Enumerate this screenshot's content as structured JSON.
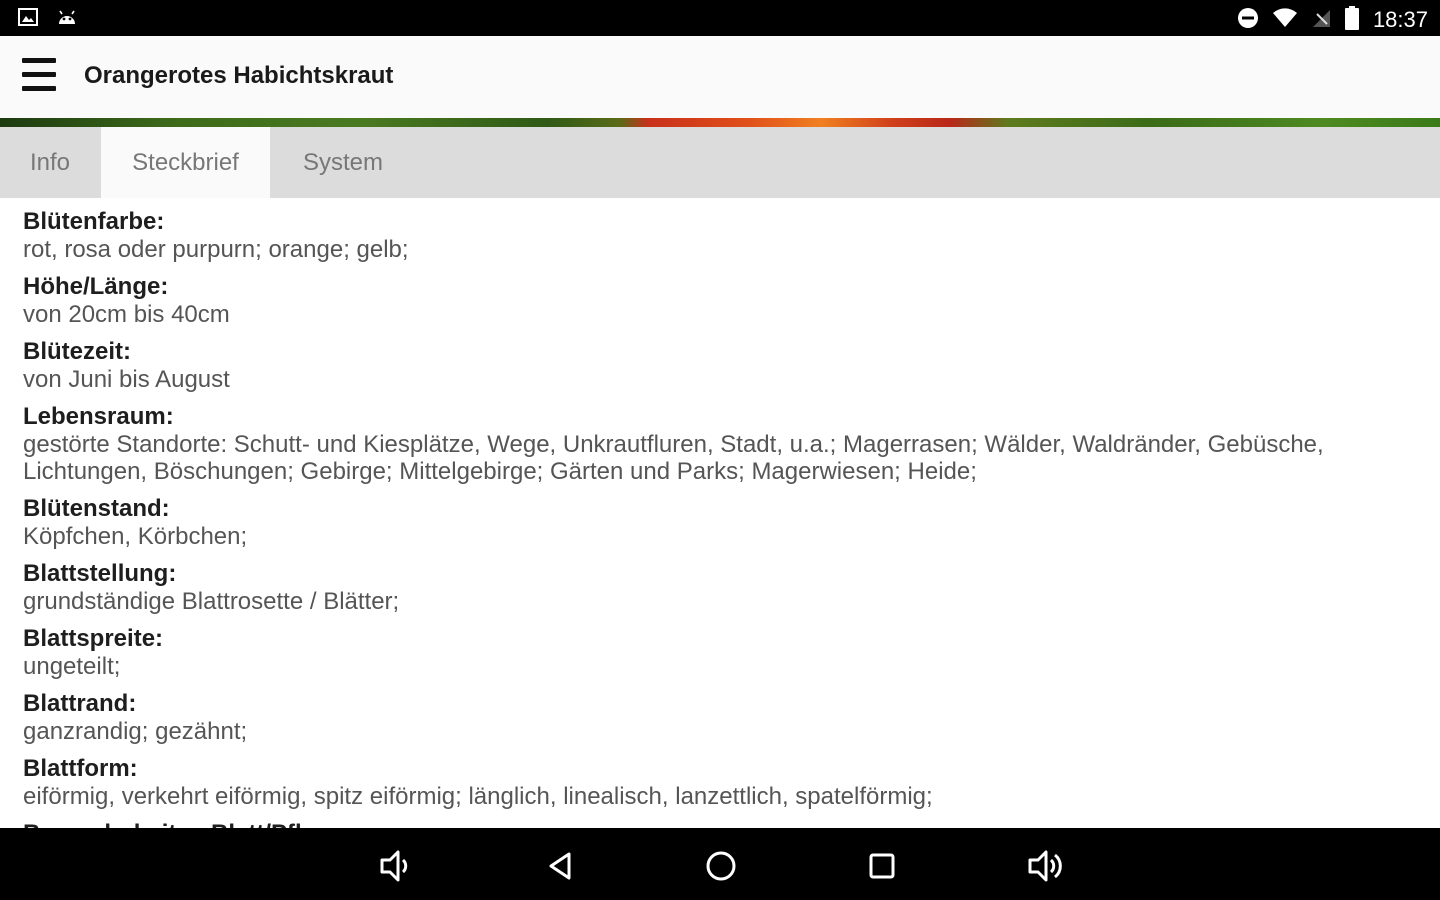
{
  "status_bar": {
    "time": "18:37",
    "left_icons": [
      "image-icon",
      "android-icon"
    ],
    "right_icons": [
      "do-not-disturb-icon",
      "wifi-icon",
      "no-signal-icon",
      "battery-icon"
    ]
  },
  "toolbar": {
    "title": "Orangerotes Habichtskraut",
    "menu_icon": "hamburger-menu-icon"
  },
  "tabs": [
    {
      "label": "Info",
      "active": false
    },
    {
      "label": "Steckbrief",
      "active": true
    },
    {
      "label": "System",
      "active": false
    }
  ],
  "fields": [
    {
      "label": "Blütenfarbe:",
      "value": "rot, rosa oder purpurn; orange; gelb;"
    },
    {
      "label": "Höhe/Länge:",
      "value": "von 20cm bis 40cm"
    },
    {
      "label": "Blütezeit:",
      "value": "von Juni bis August"
    },
    {
      "label": "Lebensraum:",
      "value": "gestörte Standorte: Schutt- und Kiesplätze, Wege, Unkrautfluren, Stadt, u.a.; Magerrasen; Wälder, Waldränder, Gebüsche, Lichtungen, Böschungen; Gebirge; Mittelgebirge; Gärten und Parks; Magerwiesen; Heide;"
    },
    {
      "label": "Blütenstand:",
      "value": "Köpfchen, Körbchen;"
    },
    {
      "label": "Blattstellung:",
      "value": "grundständige Blattrosette / Blätter;"
    },
    {
      "label": "Blattspreite:",
      "value": "ungeteilt;"
    },
    {
      "label": "Blattrand:",
      "value": "ganzrandig; gezähnt;"
    },
    {
      "label": "Blattform:",
      "value": "eiförmig, verkehrt eiförmig, spitz eiförmig; länglich, linealisch, lanzettlich, spatelförmig;"
    },
    {
      "label": "Besonderheiten Blatt/Pflanze:",
      "value": ""
    }
  ],
  "nav_bar": {
    "buttons": [
      "volume-down-icon",
      "back-icon",
      "home-icon",
      "recents-icon",
      "volume-up-icon"
    ]
  },
  "colors": {
    "status_bar": "#000000",
    "toolbar": "#fafafa",
    "tab_bar": "#dcdcdc",
    "active_tab": "#fafafa",
    "label_text": "#1e1e1e",
    "value_text": "#555555"
  }
}
